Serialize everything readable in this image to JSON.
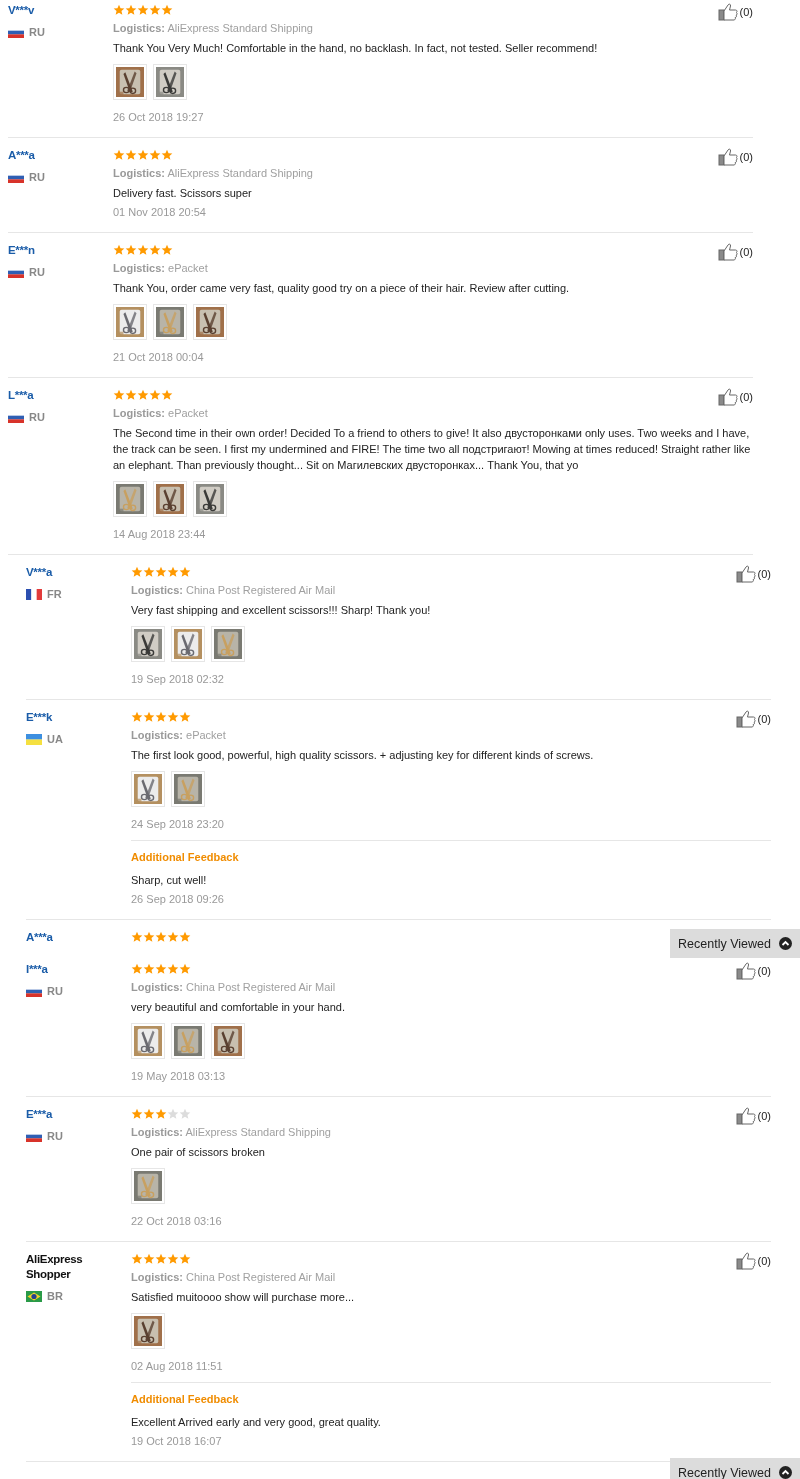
{
  "segments": [
    {
      "reviews": [
        {
          "name": "V***v",
          "name_is_link": true,
          "country": "RU",
          "flag_icon": {
            "kind": "ru"
          },
          "stars": 5,
          "logistics_label": "Logistics:",
          "logistics": "AliExpress Standard Shipping",
          "text": "Thank You Very Much! Comfortable in the hand, no backlash. In fact, not tested. Seller recommend!",
          "photos": [
            {
              "kind": "picture"
            },
            {
              "kind": "picture"
            }
          ],
          "date": "26 Oct 2018 19:27",
          "likes": "(0)"
        },
        {
          "name": "A***a",
          "name_is_link": true,
          "country": "RU",
          "flag_icon": {
            "kind": "ru"
          },
          "stars": 5,
          "logistics_label": "Logistics:",
          "logistics": "AliExpress Standard Shipping",
          "text": "Delivery fast. Scissors super",
          "date": "01 Nov 2018 20:54",
          "likes": "(0)"
        },
        {
          "name": "E***n",
          "name_is_link": true,
          "country": "RU",
          "flag_icon": {
            "kind": "ru"
          },
          "stars": 5,
          "logistics_label": "Logistics:",
          "logistics": "ePacket",
          "text": "Thank You, order came very fast, quality good try on a piece of their hair. Review after cutting.",
          "photos": [
            {
              "kind": "picture"
            },
            {
              "kind": "picture"
            },
            {
              "kind": "picture"
            }
          ],
          "date": "21 Oct 2018 00:04",
          "likes": "(0)"
        },
        {
          "name": "L***a",
          "name_is_link": true,
          "country": "RU",
          "flag_icon": {
            "kind": "ru"
          },
          "stars": 5,
          "logistics_label": "Logistics:",
          "logistics": "ePacket",
          "text": "The Second time in their own order! Decided To a friend to others to give! It also двусторонками only uses. Two weeks and I have, the track can be seen. I first my undermined and FIRE! The time two all подстригают! Mowing at times reduced! Straight rather like an elephant. Than previously thought... Sit on Магилевских двусторонках... Thank You, that yo",
          "photos": [
            {
              "kind": "picture"
            },
            {
              "kind": "picture"
            },
            {
              "kind": "picture"
            }
          ],
          "date": "14 Aug 2018 23:44",
          "likes": "(0)"
        }
      ]
    },
    {
      "reviews": [
        {
          "name": "V***a",
          "name_is_link": true,
          "country": "FR",
          "flag_icon": {
            "kind": "fr"
          },
          "stars": 5,
          "logistics_label": "Logistics:",
          "logistics": "China Post Registered Air Mail",
          "text": "Very fast shipping and excellent scissors!!! Sharp! Thank you!",
          "photos": [
            {
              "kind": "picture"
            },
            {
              "kind": "picture"
            },
            {
              "kind": "picture"
            }
          ],
          "date": "19 Sep 2018 02:32",
          "likes": "(0)"
        },
        {
          "name": "E***k",
          "name_is_link": true,
          "country": "UA",
          "flag_icon": {
            "kind": "ua"
          },
          "stars": 5,
          "logistics_label": "Logistics:",
          "logistics": "ePacket",
          "text": "The first look good, powerful, high quality scissors. + adjusting key for different kinds of screws.",
          "photos": [
            {
              "kind": "picture"
            },
            {
              "kind": "picture"
            }
          ],
          "date": "24 Sep 2018 23:20",
          "likes": "(0)",
          "additional": {
            "title": "Additional Feedback",
            "text": "Sharp, cut well!",
            "date": "26 Sep 2018 09:26"
          }
        },
        {
          "kind": "cut",
          "name": "A***a",
          "name_is_link": true,
          "stars": 5
        }
      ]
    },
    {
      "reviews": [
        {
          "name": "I***a",
          "name_is_link": true,
          "country": "RU",
          "flag_icon": {
            "kind": "ru"
          },
          "stars": 5,
          "logistics_label": "Logistics:",
          "logistics": "China Post Registered Air Mail",
          "text": "very beautiful and comfortable in your hand.",
          "photos": [
            {
              "kind": "picture"
            },
            {
              "kind": "picture"
            },
            {
              "kind": "picture"
            }
          ],
          "date": "19 May 2018 03:13",
          "likes": "(0)"
        },
        {
          "name": "E***a",
          "name_is_link": true,
          "country": "RU",
          "flag_icon": {
            "kind": "ru"
          },
          "stars": 3,
          "logistics_label": "Logistics:",
          "logistics": "AliExpress Standard Shipping",
          "text": "One pair of scissors broken",
          "photos": [
            {
              "kind": "picture"
            }
          ],
          "date": "22 Oct 2018 03:16",
          "likes": "(0)"
        },
        {
          "name": "AliExpress Shopper",
          "name_is_link": false,
          "country": "BR",
          "flag_icon": {
            "kind": "br"
          },
          "stars": 5,
          "logistics_label": "Logistics:",
          "logistics": "China Post Registered Air Mail",
          "text": "Satisfied muitoooo show will purchase more...",
          "photos": [
            {
              "kind": "picture"
            }
          ],
          "date": "02 Aug 2018 11:51",
          "likes": "(0)",
          "additional": {
            "title": "Additional Feedback",
            "text": "Excellent Arrived early and very good, great quality.",
            "date": "19 Oct 2018 16:07"
          }
        }
      ]
    }
  ],
  "recently_viewed": [
    {
      "label": "Recently Viewed"
    },
    {
      "label": "Recently Viewed"
    }
  ]
}
